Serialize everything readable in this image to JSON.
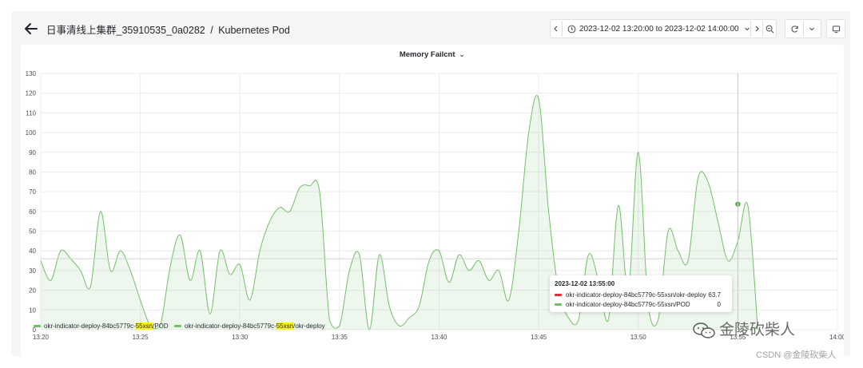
{
  "header": {
    "title": "日事清线上集群_35910535_0a0282",
    "breadcrumb_sep": "/",
    "subtitle": "Kubernetes Pod"
  },
  "toolbar": {
    "time_range": "2023-12-02 13:20:00 to 2023-12-02 14:00:00",
    "icons": [
      "chevron-left-icon",
      "clock-icon",
      "chevron-down-icon",
      "chevron-right-icon",
      "zoom-out-icon",
      "refresh-icon",
      "chevron-down-icon",
      "tv-icon"
    ]
  },
  "panel": {
    "title": "Memory Failcnt",
    "title_caret": "⌄"
  },
  "chart_data": {
    "type": "area",
    "xlim": [
      "13:20",
      "14:00"
    ],
    "ylim": [
      0,
      130
    ],
    "x_ticks": [
      "13:20",
      "13:25",
      "13:30",
      "13:35",
      "13:40",
      "13:45",
      "13:50",
      "13:55",
      "14:00"
    ],
    "y_ticks": [
      "0",
      "10",
      "20",
      "30",
      "40",
      "50",
      "60",
      "70",
      "80",
      "90",
      "100",
      "110",
      "120",
      "130"
    ],
    "grid": true,
    "legend_placement": "bottom-left",
    "series": [
      {
        "name": "okr-indicator-deploy-84bc5779c-55xsn/POD",
        "color": "#73bf69",
        "x": [
          "13:20",
          "13:20.5",
          "13:21",
          "13:21.5",
          "13:22",
          "13:22.5",
          "13:23",
          "13:23.5",
          "13:24",
          "13:24.5",
          "13:25",
          "13:25.5",
          "13:26",
          "13:26.5",
          "13:27",
          "13:27.5",
          "13:28",
          "13:28.5",
          "13:29",
          "13:29.5",
          "13:30",
          "13:30.5",
          "13:31",
          "13:31.5",
          "13:32",
          "13:32.5",
          "13:33",
          "13:33.5",
          "13:34",
          "13:34.5",
          "13:35",
          "13:35.5",
          "13:36",
          "13:36.5",
          "13:37",
          "13:37.5",
          "13:38",
          "13:38.5",
          "13:39",
          "13:39.5",
          "13:40",
          "13:40.5",
          "13:41",
          "13:41.5",
          "13:42",
          "13:42.5",
          "13:43",
          "13:43.5",
          "13:44",
          "13:44.5",
          "13:45",
          "13:45.5",
          "13:46",
          "13:46.5",
          "13:47",
          "13:47.5",
          "13:48",
          "13:48.5",
          "13:49",
          "13:49.5",
          "13:50",
          "13:50.5",
          "13:51",
          "13:51.5",
          "13:52",
          "13:52.5",
          "13:53",
          "13:53.5",
          "13:54",
          "13:54.5",
          "13:55",
          "13:55.5",
          "13:56"
        ],
        "values": [
          35,
          25,
          40,
          36,
          30,
          22,
          60,
          30,
          40,
          30,
          15,
          2,
          2,
          32,
          48,
          25,
          40,
          8,
          40,
          28,
          33,
          15,
          40,
          55,
          62,
          60,
          72,
          73,
          70,
          5,
          2,
          30,
          38,
          0,
          38,
          12,
          2,
          6,
          12,
          35,
          40,
          24,
          38,
          30,
          35,
          25,
          30,
          15,
          50,
          100,
          117,
          60,
          20,
          6,
          5,
          38,
          25,
          5,
          63,
          20,
          90,
          12,
          5,
          50,
          40,
          35,
          77,
          75,
          55,
          35,
          45,
          63,
          0
        ],
        "marker": {
          "x": "13:55",
          "y": 63.7
        }
      }
    ],
    "crosshair": {
      "x": "13:55",
      "y_display": 36
    }
  },
  "tooltip": {
    "time": "2023-12-02 13:55:00",
    "rows": [
      {
        "name": "okr-indicator-deploy-84bc5779c-55xsn/okr-deploy",
        "value": "63.7",
        "color": "#e0313b"
      },
      {
        "name": "okr-indicator-deploy-84bc5779c-55xsn/POD",
        "value": "0",
        "color": "#73bf69"
      }
    ]
  },
  "legend": {
    "items": [
      {
        "prefix": "okr-indicator-deploy-84bc5779c-",
        "highlight": "55xsn",
        "suffix": "/POD",
        "color": "#73bf69"
      },
      {
        "prefix": "okr-indicator-deploy-84bc5779c-",
        "highlight": "55xsn",
        "suffix": "/okr-deploy",
        "color": "#73bf69"
      }
    ]
  },
  "watermark": {
    "main": "金陵砍柴人",
    "sub": "CSDN @金陵砍柴人"
  }
}
